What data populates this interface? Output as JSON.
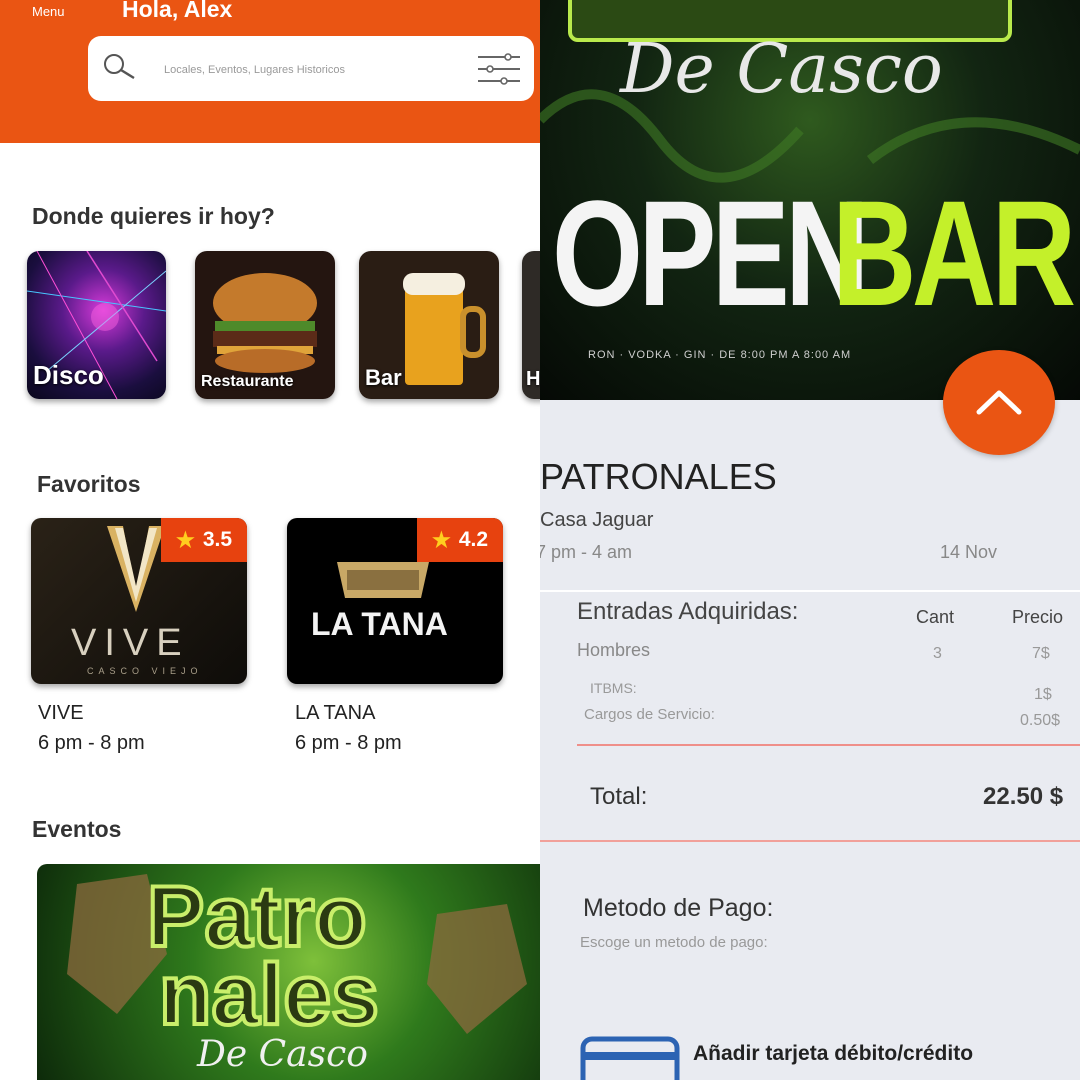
{
  "left": {
    "header": {
      "menu_label": "Menu",
      "greeting": "Hola, Alex",
      "search_placeholder": "Locales, Eventos, Lugares Historicos",
      "colors": {
        "accent": "#ea5513"
      }
    },
    "categories_title": "Donde quieres ir hoy?",
    "categories": [
      {
        "label": "Disco"
      },
      {
        "label": "Restaurante"
      },
      {
        "label": "Bar"
      },
      {
        "label": "H"
      }
    ],
    "favorites_title": "Favoritos",
    "favorites": [
      {
        "logo_text": "VIVE",
        "logo_sub": "CASCO VIEJO",
        "rating": "3.5",
        "name": "VIVE",
        "time": "6 pm - 8 pm"
      },
      {
        "logo_text": "LA TANA",
        "rating": "4.2",
        "name": "LA TANA",
        "time": "6 pm - 8 pm"
      }
    ],
    "events_title": "Eventos",
    "event_banner": {
      "line1": "Patro",
      "line2": "nales",
      "script": "De Casco"
    }
  },
  "right": {
    "poster": {
      "script": "De Casco",
      "open": "OPEN",
      "bar": "BAR",
      "drinks_line": "RON · VODKA · GIN · DE 8:00 PM A 8:00 AM"
    },
    "event": {
      "title": "PATRONALES",
      "venue": "Casa Jaguar",
      "time": "7 pm - 4 am",
      "date": "14 Nov"
    },
    "tickets": {
      "title": "Entradas Adquiridas:",
      "col_qty": "Cant",
      "col_price": "Precio",
      "row_label": "Hombres",
      "row_qty": "3",
      "row_price": "7$",
      "itbms_label": "ITBMS:",
      "itbms_value": "1$",
      "service_label": "Cargos de Servicio:",
      "service_value": "0.50$",
      "total_label": "Total:",
      "total_value": "22.50 $"
    },
    "payment": {
      "title": "Metodo de Pago:",
      "subtitle": "Escoge un metodo de pago:",
      "add_card": "Añadir tarjeta débito/crédito"
    }
  }
}
